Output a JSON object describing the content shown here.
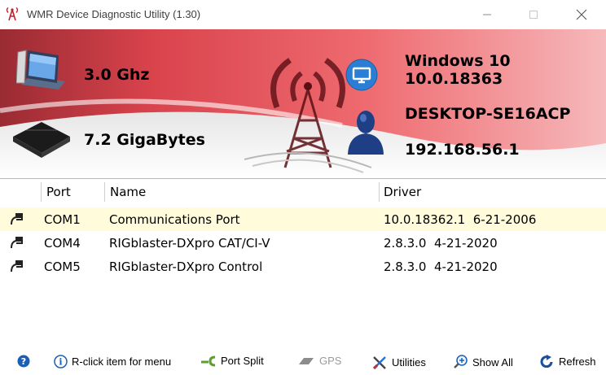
{
  "window": {
    "title": "WMR Device Diagnostic Utility (1.30)"
  },
  "system": {
    "cpu_speed": "3.0 Ghz",
    "memory": "7.2 GigaBytes",
    "os_name": "Windows 10",
    "os_version": "10.0.18363",
    "computer_name": "DESKTOP-SE16ACP",
    "ip_address": "192.168.56.1"
  },
  "table": {
    "columns": [
      "Port",
      "Name",
      "Driver"
    ],
    "rows": [
      {
        "port": "COM1",
        "name": "Communications Port",
        "driver": "10.0.18362.1  6-21-2006",
        "selected": true
      },
      {
        "port": "COM4",
        "name": "RIGblaster-DXpro CAT/CI-V",
        "driver": "2.8.3.0  4-21-2020",
        "selected": false
      },
      {
        "port": "COM5",
        "name": "RIGblaster-DXpro Control",
        "driver": "2.8.3.0  4-21-2020",
        "selected": false
      }
    ]
  },
  "statusbar": {
    "hint": "R-click item for menu",
    "port_split": "Port Split",
    "gps": "GPS",
    "utilities": "Utilities",
    "show_all": "Show All",
    "refresh": "Refresh"
  },
  "colors": {
    "selected_row": "#fffbdb",
    "banner_red": "#e84a52",
    "info_icon_blue": "#1a5fb4"
  }
}
